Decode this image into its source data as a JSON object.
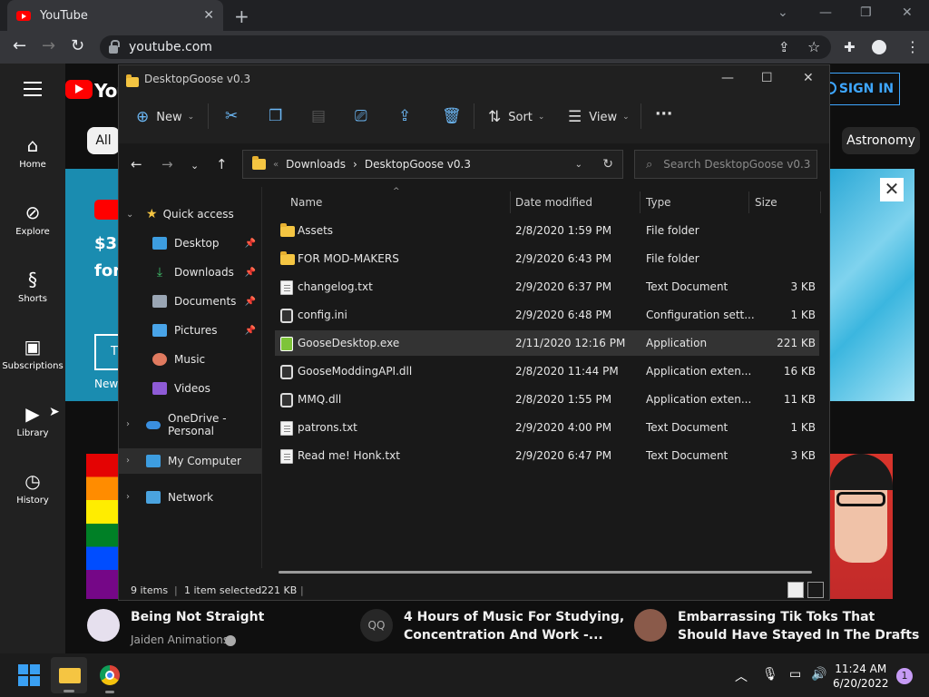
{
  "browser": {
    "tab_title": "YouTube",
    "url": "youtube.com"
  },
  "youtube": {
    "logo_text": "You",
    "signin_label": "SIGN IN",
    "guide": [
      {
        "label": "Home",
        "icon": "home-icon"
      },
      {
        "label": "Explore",
        "icon": "compass-icon"
      },
      {
        "label": "Shorts",
        "icon": "shorts-icon"
      },
      {
        "label": "Subscriptions",
        "icon": "subscriptions-icon"
      },
      {
        "label": "Library",
        "icon": "library-icon"
      },
      {
        "label": "History",
        "icon": "history-icon"
      }
    ],
    "chips": [
      "All",
      "Astronomy"
    ],
    "banner": {
      "line1": "$3",
      "line2": "for",
      "button_text": "T",
      "new_text": "New"
    },
    "videos": [
      {
        "title": "Being Not Straight",
        "channel": "Jaiden Animations"
      },
      {
        "title_line1": "4 Hours of Music For Studying,",
        "title_line2": "Concentration And Work -...",
        "avatar_text": "QQ"
      },
      {
        "title_line1": "Embarrassing Tik Toks That",
        "title_line2": "Should Have Stayed In The Drafts"
      }
    ]
  },
  "explorer": {
    "title": "DesktopGoose v0.3",
    "commands": {
      "new": "New",
      "sort": "Sort",
      "view": "View"
    },
    "breadcrumb": [
      "Downloads",
      "DesktopGoose v0.3"
    ],
    "search_placeholder": "Search DesktopGoose v0.3",
    "nav": {
      "quick_access": "Quick access",
      "items": [
        "Desktop",
        "Downloads",
        "Documents",
        "Pictures",
        "Music",
        "Videos"
      ],
      "onedrive": "OneDrive - Personal",
      "my_computer": "My Computer",
      "network": "Network"
    },
    "columns": [
      "Name",
      "Date modified",
      "Type",
      "Size"
    ],
    "files": [
      {
        "name": "Assets",
        "date": "2/8/2020 1:59 PM",
        "type": "File folder",
        "size": "",
        "icon": "folder-icon"
      },
      {
        "name": "FOR MOD-MAKERS",
        "date": "2/9/2020 6:43 PM",
        "type": "File folder",
        "size": "",
        "icon": "folder-icon"
      },
      {
        "name": "changelog.txt",
        "date": "2/9/2020 6:37 PM",
        "type": "Text Document",
        "size": "3 KB",
        "icon": "text-file-icon"
      },
      {
        "name": "config.ini",
        "date": "2/9/2020 6:48 PM",
        "type": "Configuration sett...",
        "size": "1 KB",
        "icon": "config-file-icon"
      },
      {
        "name": "GooseDesktop.exe",
        "date": "2/11/2020 12:16 PM",
        "type": "Application",
        "size": "221 KB",
        "icon": "app-icon"
      },
      {
        "name": "GooseModdingAPI.dll",
        "date": "2/8/2020 11:44 PM",
        "type": "Application exten...",
        "size": "16 KB",
        "icon": "dll-file-icon"
      },
      {
        "name": "MMQ.dll",
        "date": "2/8/2020 1:55 PM",
        "type": "Application exten...",
        "size": "11 KB",
        "icon": "dll-file-icon"
      },
      {
        "name": "patrons.txt",
        "date": "2/9/2020 4:00 PM",
        "type": "Text Document",
        "size": "1 KB",
        "icon": "text-file-icon"
      },
      {
        "name": "Read me! Honk.txt",
        "date": "2/9/2020 6:47 PM",
        "type": "Text Document",
        "size": "3 KB",
        "icon": "text-file-icon"
      }
    ],
    "status": {
      "count": "9 items",
      "selected": "1 item selected",
      "size": "221 KB"
    }
  },
  "taskbar": {
    "time": "11:24 AM",
    "date": "6/20/2022",
    "notifications": "1"
  }
}
